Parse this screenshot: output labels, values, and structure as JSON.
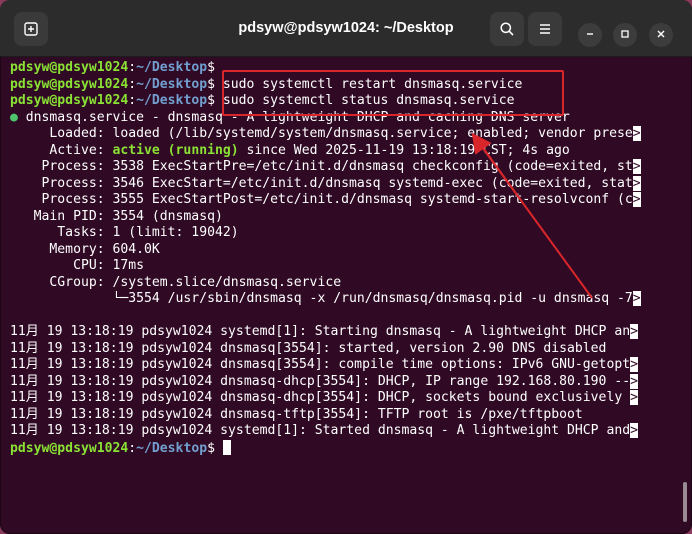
{
  "window": {
    "title": "pdsyw@pdsyw1024: ~/Desktop"
  },
  "colors": {
    "terminal_bg": "#300a24",
    "prompt_user": "#8ae234",
    "prompt_path": "#729fcf",
    "highlight_box": "#d9262b"
  },
  "icons": {
    "new_tab": "new-tab-icon",
    "search": "search-icon",
    "menu": "hamburger-menu-icon",
    "minimize": "minimize-icon",
    "maximize": "maximize-icon",
    "close": "close-icon"
  },
  "prompt": {
    "user": "pdsyw@pdsyw1024",
    "colon": ":",
    "path": "~/Desktop",
    "symbol": "$"
  },
  "commands": {
    "cmd1": "",
    "cmd2": " sudo systemctl restart dnsmasq.service",
    "cmd3": " sudo systemctl status dnsmasq.service"
  },
  "status": {
    "dot": "●",
    "header": " dnsmasq.service - dnsmasq - A lightweight DHCP and caching DNS server",
    "loaded": "     Loaded: loaded (/lib/systemd/system/dnsmasq.service; enabled; vendor prese",
    "active_label": "     Active: ",
    "active_state": "active (running)",
    "active_rest": " since Wed 2025-11-19 13:18:19 CST; 4s ago",
    "process1": "    Process: 3538 ExecStartPre=/etc/init.d/dnsmasq checkconfig (code=exited, st",
    "process2": "    Process: 3546 ExecStart=/etc/init.d/dnsmasq systemd-exec (code=exited, stat",
    "process3": "    Process: 3555 ExecStartPost=/etc/init.d/dnsmasq systemd-start-resolvconf (c",
    "mainpid": "   Main PID: 3554 (dnsmasq)",
    "tasks": "      Tasks: 1 (limit: 19042)",
    "memory": "     Memory: 604.0K",
    "cpu": "        CPU: 17ms",
    "cgroup": "     CGroup: /system.slice/dnsmasq.service",
    "cgroup_child": "             └─3554 /usr/sbin/dnsmasq -x /run/dnsmasq/dnsmasq.pid -u dnsmasq -7",
    "truncation_marker": ">"
  },
  "logs": [
    "11月 19 13:18:19 pdsyw1024 systemd[1]: Starting dnsmasq - A lightweight DHCP an",
    "11月 19 13:18:19 pdsyw1024 dnsmasq[3554]: started, version 2.90 DNS disabled",
    "11月 19 13:18:19 pdsyw1024 dnsmasq[3554]: compile time options: IPv6 GNU-getopt",
    "11月 19 13:18:19 pdsyw1024 dnsmasq-dhcp[3554]: DHCP, IP range 192.168.80.190 --",
    "11月 19 13:18:19 pdsyw1024 dnsmasq-dhcp[3554]: DHCP, sockets bound exclusively ",
    "11月 19 13:18:19 pdsyw1024 dnsmasq-tftp[3554]: TFTP root is /pxe/tftpboot",
    "11月 19 13:18:19 pdsyw1024 systemd[1]: Started dnsmasq - A lightweight DHCP and"
  ]
}
